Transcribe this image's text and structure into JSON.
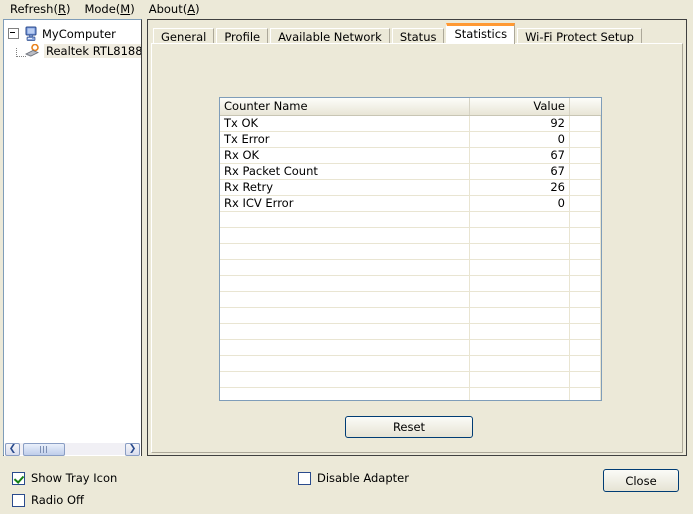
{
  "menu": {
    "items": [
      {
        "label": "Refresh",
        "accel": "R"
      },
      {
        "label": "Mode",
        "accel": "M"
      },
      {
        "label": "About",
        "accel": "A"
      }
    ]
  },
  "tree": {
    "root": {
      "label": "MyComputer",
      "icon": "computer-icon",
      "expanded": true
    },
    "child": {
      "label": "Realtek RTL8188",
      "icon": "wireless-adapter-icon",
      "selected": true
    }
  },
  "scrollbar": {
    "left_arrow": "❮",
    "right_arrow": "❯"
  },
  "tabs": [
    {
      "label": "General",
      "active": false
    },
    {
      "label": "Profile",
      "active": false
    },
    {
      "label": "Available Network",
      "active": false
    },
    {
      "label": "Status",
      "active": false
    },
    {
      "label": "Statistics",
      "active": true
    },
    {
      "label": "Wi-Fi Protect Setup",
      "active": false
    }
  ],
  "statistics": {
    "columns": [
      "Counter Name",
      "Value",
      ""
    ],
    "rows": [
      {
        "name": "Tx OK",
        "value": "92"
      },
      {
        "name": "Tx Error",
        "value": "0"
      },
      {
        "name": "Rx OK",
        "value": "67"
      },
      {
        "name": "Rx Packet Count",
        "value": "67"
      },
      {
        "name": "Rx Retry",
        "value": "26"
      },
      {
        "name": "Rx ICV Error",
        "value": "0"
      }
    ],
    "empty_row_count": 14,
    "reset_label": "Reset"
  },
  "bottom": {
    "show_tray_icon": {
      "label": "Show Tray Icon",
      "checked": true
    },
    "radio_off": {
      "label": "Radio Off",
      "checked": false
    },
    "disable_adapter": {
      "label": "Disable Adapter",
      "checked": false
    },
    "close_label": "Close"
  },
  "colors": {
    "window_face": "#ece9d8",
    "active_tab_accent": "#ff9933",
    "button_border": "#003c74",
    "check_green": "#148014",
    "panel_border": "#7f9db9"
  }
}
